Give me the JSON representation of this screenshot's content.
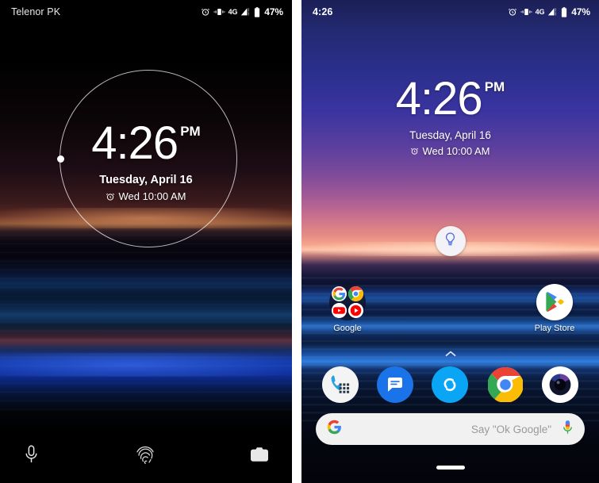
{
  "lock_screen": {
    "status_bar": {
      "carrier": "Telenor PK",
      "icons": [
        "alarm-icon",
        "vibrate-icon",
        "signal-icon"
      ],
      "network_label": "4G",
      "battery_label": "47%"
    },
    "clock": {
      "time": "4:26",
      "ampm": "PM",
      "date": "Tuesday, April 16",
      "alarm": "Wed 10:00 AM"
    },
    "bottom_actions": [
      {
        "name": "voice-assistant-icon",
        "label": "Voice assistant"
      },
      {
        "name": "fingerprint-icon",
        "label": "Fingerprint sensor"
      },
      {
        "name": "camera-icon",
        "label": "Camera"
      }
    ]
  },
  "home_screen": {
    "status_bar": {
      "time": "4:26",
      "icons": [
        "alarm-icon",
        "vibrate-icon",
        "signal-icon"
      ],
      "network_label": "4G",
      "battery_label": "47%"
    },
    "clock": {
      "time": "4:26",
      "ampm": "PM",
      "date": "Tuesday, April 16",
      "alarm": "Wed 10:00 AM"
    },
    "widget": {
      "name": "lightbulb-widget",
      "label": "Lightbulb"
    },
    "apps": [
      {
        "name": "google-folder",
        "label": "Google"
      },
      {
        "name": "play-store",
        "label": "Play Store"
      }
    ],
    "drawer_handle": {
      "name": "app-drawer-chevron",
      "label": "Open app drawer"
    },
    "dock": [
      {
        "name": "phone-app",
        "label": "Phone"
      },
      {
        "name": "messages-app",
        "label": "Messages"
      },
      {
        "name": "shazam-app",
        "label": "Shazam"
      },
      {
        "name": "chrome-app",
        "label": "Chrome"
      },
      {
        "name": "camera-app",
        "label": "Camera"
      }
    ],
    "search": {
      "placeholder": "Say \"Ok Google\"",
      "value": "Say \"Ok Google\"",
      "logo": "google-g-icon",
      "mic": "microphone-icon"
    },
    "gesture_bar": {
      "name": "home-gesture-pill",
      "label": "Home"
    }
  },
  "colors": {
    "accent_blue": "#4285F4",
    "google_red": "#EA4335",
    "google_yellow": "#FBBC05",
    "google_green": "#34A853",
    "status_white": "#FFFFFF"
  }
}
